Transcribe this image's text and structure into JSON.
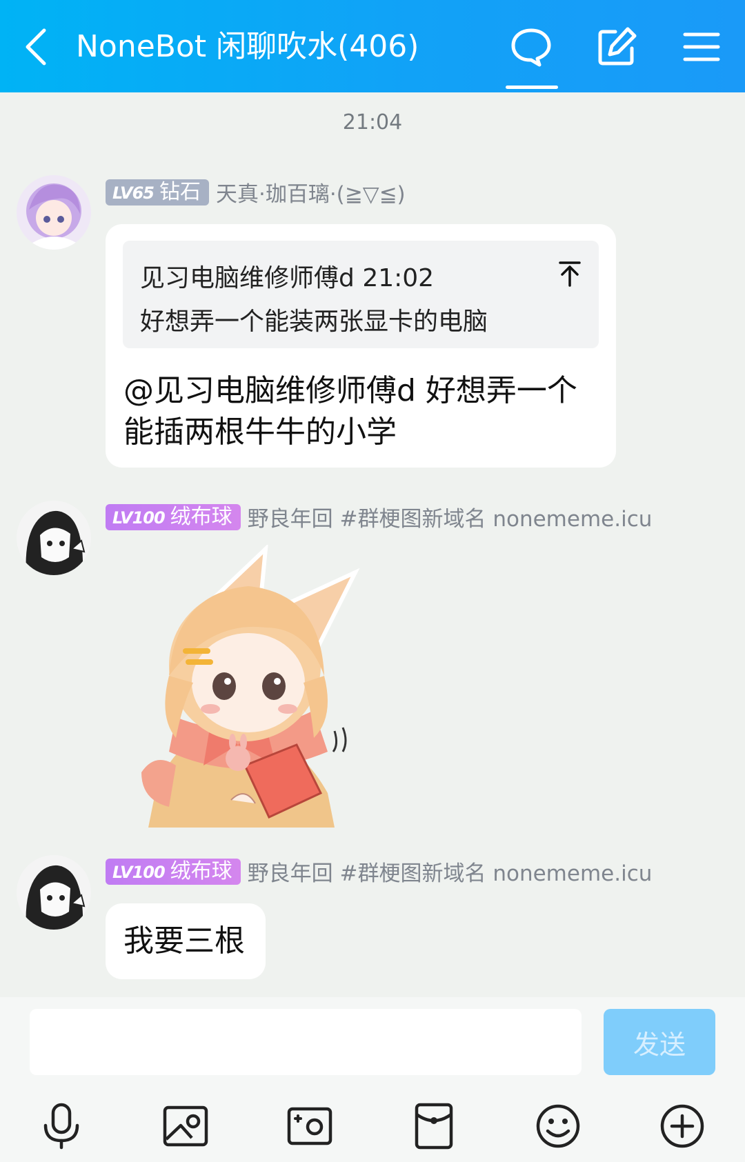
{
  "header": {
    "title": "NoneBot 闲聊吹水(406)",
    "icons": [
      "back-icon",
      "chat-icon",
      "edit-icon",
      "menu-icon"
    ]
  },
  "timestamp": "21:04",
  "messages": [
    {
      "level": "LV65",
      "title_badge": "钻石",
      "sender": "天真·珈百璃·(≧▽≦)",
      "quote": {
        "author": "见习电脑维修师傅d",
        "time": "21:02",
        "text": "好想弄一个能装两张显卡的电脑"
      },
      "text": "@见习电脑维修师傅d 好想弄一个能插两根牛牛的小学"
    },
    {
      "level": "LV100",
      "title_badge": "绒布球",
      "sender": "野良年回 #群梗图新域名 nonememe.icu",
      "sticker": "anime-girl-reading-sticker"
    },
    {
      "level": "LV100",
      "title_badge": "绒布球",
      "sender": "野良年回 #群梗图新域名 nonememe.icu",
      "text": "我要三根"
    }
  ],
  "input": {
    "value": "",
    "send_label": "发送"
  },
  "toolbar": [
    "microphone-icon",
    "image-icon",
    "camera-icon",
    "red-packet-icon",
    "emoji-icon",
    "plus-icon"
  ],
  "colors": {
    "header_gradient_start": "#00b3f5",
    "header_gradient_end": "#1a9af8",
    "badge_gray": "#a7b1c4",
    "badge_purple": "#c07cf3",
    "send_button": "#7fcdfb"
  }
}
